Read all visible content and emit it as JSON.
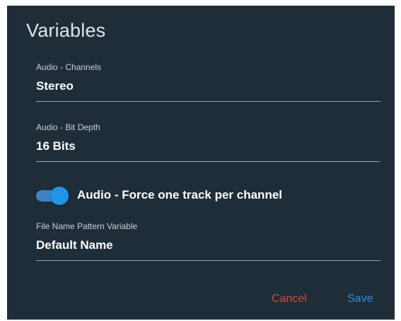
{
  "dialog": {
    "title": "Variables"
  },
  "fields": [
    {
      "label": "Audio - Channels",
      "value": "Stereo"
    },
    {
      "label": "Audio - Bit Depth",
      "value": "16 Bits"
    },
    {
      "label": "File Name Pattern Variable",
      "value": "Default Name"
    }
  ],
  "toggle": {
    "label": "Audio - Force one track per channel",
    "checked": true
  },
  "actions": {
    "cancel_label": "Cancel",
    "save_label": "Save"
  },
  "colors": {
    "background": "#1f2d39",
    "accent": "#1e95e8",
    "cancel": "#cf4a3a",
    "save": "#2f8fd8"
  }
}
